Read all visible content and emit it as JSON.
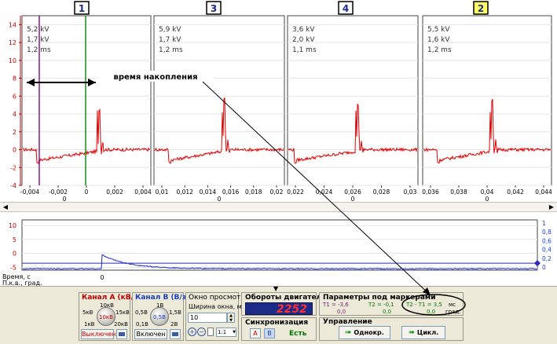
{
  "scope": {
    "channel_tabs": [
      "1",
      "3",
      "4",
      "2"
    ],
    "readouts": [
      [
        "5,2 kV",
        "1,7 kV",
        "1,2 ms"
      ],
      [
        "5,9 kV",
        "1,7 kV",
        "1,2 ms"
      ],
      [
        "3,6 kV",
        "2,0 kV",
        "1,1 ms"
      ],
      [
        "5,5 kV",
        "1,6 kV",
        "1,2 ms"
      ]
    ],
    "y_ticks": [
      "14",
      "12",
      "10",
      "8",
      "6",
      "4",
      "2",
      "0",
      "-2",
      "-4"
    ],
    "x_ticks": [
      [
        "-0,004",
        "-0,002",
        "0",
        "0,002",
        "0,004"
      ],
      [
        "0,01",
        "0,012",
        "0,014",
        "0,016",
        "0,018",
        "0,02"
      ],
      [
        "0,022",
        "0,024",
        "0,026",
        "0,028",
        "0,03"
      ],
      [
        "0,036",
        "0,038",
        "0,04",
        "0,042",
        "0,044"
      ]
    ],
    "x_zero_labels": [
      "0",
      "0",
      "0",
      "0"
    ],
    "annotation": "время накопления"
  },
  "overview": {
    "y_left": [
      "10",
      "5",
      "0",
      "-5"
    ],
    "y_right": [
      "1",
      "0,8",
      "0,6",
      "0,4",
      "0,2",
      "0"
    ],
    "time_label": "Время, с",
    "angle_label": "П.к.в., град.",
    "zero_label": "0"
  },
  "channel_a": {
    "title": "Канал А (кВ/з)",
    "dial": [
      "10кВ",
      "5кВ",
      "15кВ",
      "1кВ",
      "20кВ",
      "10кВ"
    ],
    "toggle": "Выключен"
  },
  "channel_b": {
    "title": "Канал В (В/з)",
    "dial": [
      "1В",
      "0,5В",
      "1,5В",
      "0,1В",
      "2В",
      "0,5В"
    ],
    "toggle": "Включен"
  },
  "view_window": {
    "title": "Окно просмотра",
    "width_label": "Ширина окна, мс",
    "width_value": "10",
    "zoom_value": "1:1"
  },
  "rpm": {
    "title": "Обороты двигателя",
    "value": "2252"
  },
  "sync": {
    "title": "Синхронизация",
    "a": "A",
    "b": "B",
    "status": "Есть"
  },
  "markers": {
    "title": "Параметры под маркерами",
    "t1": "T1 = -3,6",
    "t1_val": "0,0",
    "t2": "T2 = -0,1",
    "t2_val": "0,0",
    "diff": "T2 - T1 = 3,5",
    "diff_val": "0,0",
    "unit_ms": "мс",
    "unit_deg": "град."
  },
  "control": {
    "title": "Управление",
    "single": "Однокр.",
    "cycle": "Цикл."
  }
}
